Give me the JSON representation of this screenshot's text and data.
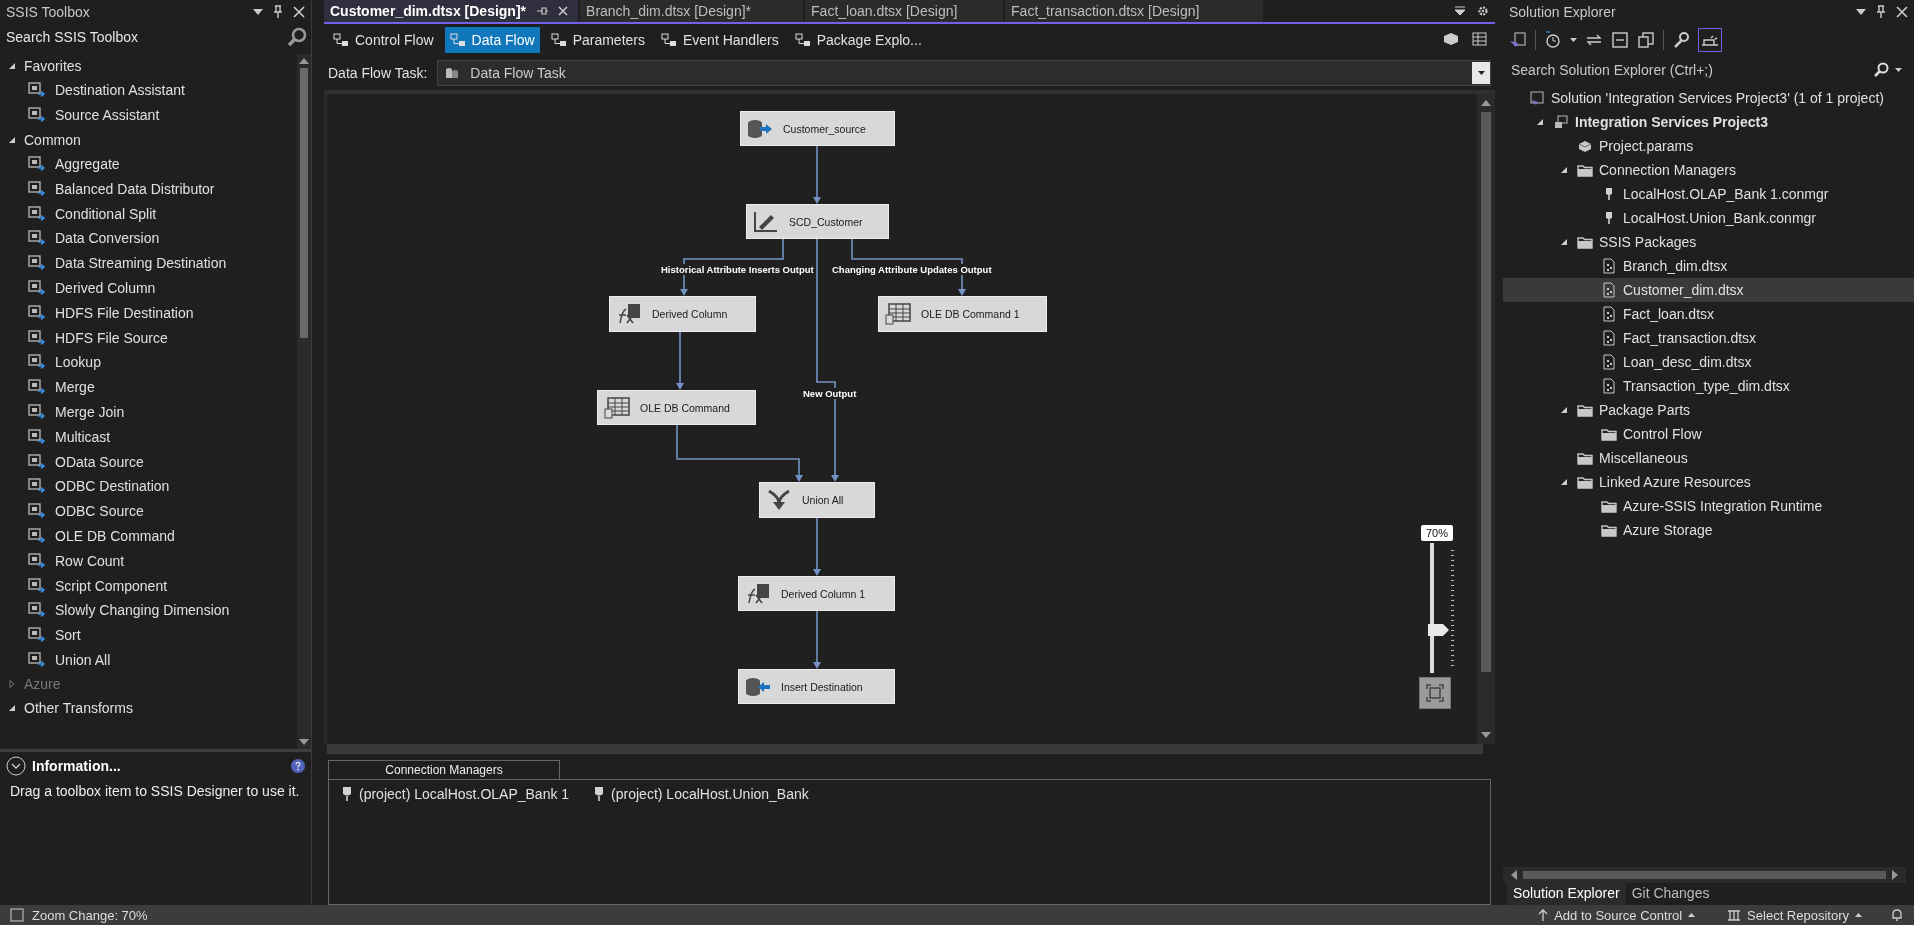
{
  "toolbox": {
    "title": "SSIS Toolbox",
    "search_placeholder": "Search SSIS Toolbox",
    "groups": [
      {
        "name": "Favorites",
        "expanded": true,
        "disabled": false,
        "items": [
          "Destination Assistant",
          "Source Assistant"
        ]
      },
      {
        "name": "Common",
        "expanded": true,
        "disabled": false,
        "items": [
          "Aggregate",
          "Balanced Data Distributor",
          "Conditional Split",
          "Data Conversion",
          "Data Streaming Destination",
          "Derived Column",
          "HDFS File Destination",
          "HDFS File Source",
          "Lookup",
          "Merge",
          "Merge Join",
          "Multicast",
          "OData Source",
          "ODBC Destination",
          "ODBC Source",
          "OLE DB Command",
          "Row Count",
          "Script Component",
          "Slowly Changing Dimension",
          "Sort",
          "Union All"
        ]
      },
      {
        "name": "Azure",
        "expanded": false,
        "disabled": true
      },
      {
        "name": "Other Transforms",
        "expanded": true,
        "disabled": false
      }
    ]
  },
  "info": {
    "title": "Information...",
    "text": "Drag a toolbox item to SSIS Designer to use it."
  },
  "document_tabs": [
    {
      "label": "Customer_dim.dtsx [Design]*",
      "selected": true
    },
    {
      "label": "Branch_dim.dtsx [Design]*",
      "selected": false
    },
    {
      "label": "Fact_loan.dtsx [Design]",
      "selected": false
    },
    {
      "label": "Fact_transaction.dtsx [Design]",
      "selected": false
    }
  ],
  "designer_tabs": [
    {
      "label": "Control Flow",
      "selected": false
    },
    {
      "label": "Data Flow",
      "selected": true
    },
    {
      "label": "Parameters",
      "selected": false
    },
    {
      "label": "Event Handlers",
      "selected": false
    },
    {
      "label": "Package Explo...",
      "selected": false
    }
  ],
  "task_selector": {
    "label": "Data Flow Task:",
    "value": "Data Flow Task"
  },
  "canvas": {
    "nodes": [
      {
        "label": "Customer_source",
        "kind": "source"
      },
      {
        "label": "SCD_Customer",
        "kind": "scd"
      },
      {
        "label": "Derived Column",
        "kind": "derived"
      },
      {
        "label": "OLE DB Command 1",
        "kind": "command"
      },
      {
        "label": "OLE DB Command",
        "kind": "command"
      },
      {
        "label": "Union All",
        "kind": "union"
      },
      {
        "label": "Derived Column 1",
        "kind": "derived"
      },
      {
        "label": "Insert Destination",
        "kind": "destination"
      }
    ],
    "path_labels": [
      "Historical Attribute Inserts Output",
      "Changing Attribute Updates Output",
      "New Output"
    ],
    "zoom": {
      "reading": "70%",
      "level": 0.31
    }
  },
  "connection_managers": {
    "tab": "Connection Managers",
    "items": [
      "(project) LocalHost.OLAP_Bank 1",
      "(project) LocalHost.Union_Bank"
    ]
  },
  "solution_explorer": {
    "title": "Solution Explorer",
    "search_placeholder": "Search Solution Explorer (Ctrl+;)",
    "tree": [
      {
        "label": "Solution 'Integration Services Project3' (1 of 1 project)",
        "kind": "solution",
        "selected": false,
        "children": [
          {
            "label": "Integration Services Project3",
            "kind": "project",
            "expanded": true,
            "selected": false,
            "children": [
              {
                "label": "Project.params",
                "kind": "params",
                "selected": false
              },
              {
                "label": "Connection Managers",
                "kind": "folder",
                "expanded": true,
                "selected": false,
                "children": [
                  {
                    "label": "LocalHost.OLAP_Bank 1.conmgr",
                    "kind": "connection",
                    "selected": false
                  },
                  {
                    "label": "LocalHost.Union_Bank.conmgr",
                    "kind": "connection",
                    "selected": false
                  }
                ]
              },
              {
                "label": "SSIS Packages",
                "kind": "folder",
                "expanded": true,
                "selected": false,
                "children": [
                  {
                    "label": "Branch_dim.dtsx",
                    "kind": "package",
                    "selected": false
                  },
                  {
                    "label": "Customer_dim.dtsx",
                    "kind": "package",
                    "selected": true
                  },
                  {
                    "label": "Fact_loan.dtsx",
                    "kind": "package",
                    "selected": false
                  },
                  {
                    "label": "Fact_transaction.dtsx",
                    "kind": "package",
                    "selected": false
                  },
                  {
                    "label": "Loan_desc_dim.dtsx",
                    "kind": "package",
                    "selected": false
                  },
                  {
                    "label": "Transaction_type_dim.dtsx",
                    "kind": "package",
                    "selected": false
                  }
                ]
              },
              {
                "label": "Package Parts",
                "kind": "folder",
                "expanded": true,
                "selected": false,
                "children": [
                  {
                    "label": "Control Flow",
                    "kind": "folder",
                    "selected": false
                  }
                ]
              },
              {
                "label": "Miscellaneous",
                "kind": "folder",
                "selected": false
              },
              {
                "label": "Linked Azure Resources",
                "kind": "folder",
                "expanded": true,
                "selected": false,
                "children": [
                  {
                    "label": "Azure-SSIS Integration Runtime",
                    "kind": "folder",
                    "selected": false
                  },
                  {
                    "label": "Azure Storage",
                    "kind": "folder",
                    "selected": false
                  }
                ]
              }
            ]
          }
        ]
      }
    ]
  },
  "bottom_tabs": [
    {
      "label": "Solution Explorer",
      "selected": true
    },
    {
      "label": "Git Changes",
      "selected": false
    }
  ],
  "status_bar": {
    "message": "Zoom Change: 70%",
    "items": [
      "Add to Source Control",
      "Select Repository"
    ]
  }
}
